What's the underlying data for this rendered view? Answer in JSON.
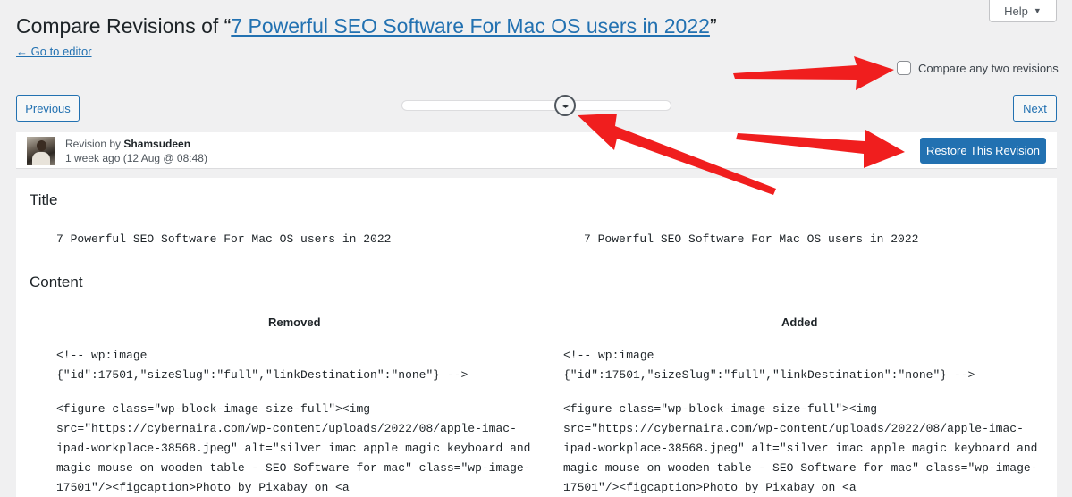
{
  "help": {
    "label": "Help",
    "caret": "▼"
  },
  "header": {
    "title_prefix": "Compare Revisions of “",
    "title_link": "7 Powerful SEO Software For Mac OS users in 2022",
    "title_suffix": "”",
    "go_to_editor": "← Go to editor"
  },
  "compare": {
    "label": "Compare any two revisions",
    "checked": false
  },
  "nav": {
    "previous": "Previous",
    "next": "Next",
    "slider_handle": "◂▸"
  },
  "revision": {
    "by_prefix": "Revision by ",
    "author": "Shamsudeen",
    "date": "1 week ago (12 Aug @ 08:48)",
    "restore_label": "Restore This Revision"
  },
  "diff": {
    "title_heading": "Title",
    "title_left": "7 Powerful SEO Software For Mac OS users in 2022",
    "title_right": "7 Powerful SEO Software For Mac OS users in 2022",
    "content_heading": "Content",
    "removed_label": "Removed",
    "added_label": "Added",
    "left_block1": "<!-- wp:image\n{\"id\":17501,\"sizeSlug\":\"full\",\"linkDestination\":\"none\"} -->",
    "left_block2": "<figure class=\"wp-block-image size-full\"><img\nsrc=\"https://cybernaira.com/wp-content/uploads/2022/08/apple-imac-\nipad-workplace-38568.jpeg\" alt=\"silver imac apple magic keyboard and\nmagic mouse on wooden table - SEO Software for mac\" class=\"wp-image-\n17501\"/><figcaption>Photo by Pixabay on <a",
    "right_block1": "<!-- wp:image\n{\"id\":17501,\"sizeSlug\":\"full\",\"linkDestination\":\"none\"} -->",
    "right_block2": "<figure class=\"wp-block-image size-full\"><img\nsrc=\"https://cybernaira.com/wp-content/uploads/2022/08/apple-imac-\nipad-workplace-38568.jpeg\" alt=\"silver imac apple magic keyboard and\nmagic mouse on wooden table - SEO Software for mac\" class=\"wp-image-\n17501\"/><figcaption>Photo by Pixabay on <a"
  },
  "colors": {
    "accent": "#2271b1",
    "arrow": "#f01e1e",
    "background": "#f0f0f1"
  }
}
